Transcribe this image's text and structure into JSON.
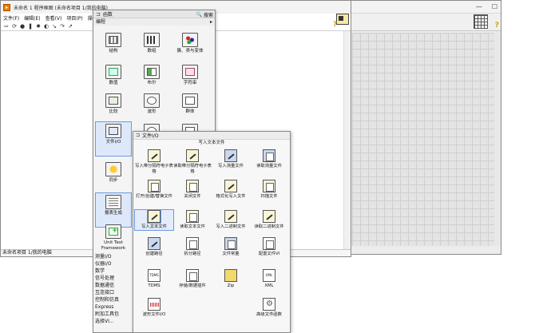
{
  "block_diagram": {
    "title": "未命名 1 程序框图 (未命名项目 1/我的电脑)",
    "menu": [
      "文件(F)",
      "编辑(E)",
      "查看(V)",
      "项目(P)",
      "操作"
    ],
    "status": "未命名项目 1/我的电脑"
  },
  "functions_palette": {
    "title": "函数",
    "search_label": "搜索",
    "category": "编程",
    "items": [
      {
        "label": "结构",
        "icon": "structures-icon"
      },
      {
        "label": "数组",
        "icon": "array-icon"
      },
      {
        "label": "簇、类与变体",
        "icon": "cluster-icon"
      },
      {
        "label": "数值",
        "icon": "numeric-icon"
      },
      {
        "label": "布尔",
        "icon": "boolean-icon"
      },
      {
        "label": "字符串",
        "icon": "string-icon"
      },
      {
        "label": "比较",
        "icon": "comparison-icon"
      },
      {
        "label": "波形",
        "icon": "waveform-icon"
      },
      {
        "label": "群体",
        "icon": "group-icon"
      },
      {
        "label": "文件I/O",
        "icon": "file-io-icon"
      },
      {
        "label": "同步",
        "icon": "sync-icon"
      },
      {
        "label": "报表生成",
        "icon": "report-icon"
      },
      {
        "label": "Unit Test Framework",
        "icon": "unit-test-icon"
      }
    ],
    "categories": [
      "测量I/O",
      "仪器I/O",
      "数学",
      "信号处理",
      "数据通信",
      "互连接口",
      "控制和仿真",
      "Express",
      "附加工具包",
      "选择VI..."
    ]
  },
  "file_io_palette": {
    "title": "文件I/O",
    "tooltip": "写入文本文件",
    "items": [
      {
        "label": "写入带分隔符电子表格",
        "icon": "write-delimited-icon"
      },
      {
        "label": "读取带分隔符电子表格",
        "icon": "read-delimited-icon"
      },
      {
        "label": "写入测量文件",
        "icon": "write-measurement-icon"
      },
      {
        "label": "读取测量文件",
        "icon": "read-measurement-icon"
      },
      {
        "label": "打开/创建/替换文件",
        "icon": "open-file-icon"
      },
      {
        "label": "关闭文件",
        "icon": "close-file-icon"
      },
      {
        "label": "格式化写入文件",
        "icon": "format-write-icon"
      },
      {
        "label": "扫描文件",
        "icon": "scan-file-icon"
      },
      {
        "label": "写入文本文件",
        "icon": "write-text-icon"
      },
      {
        "label": "读取文本文件",
        "icon": "read-text-icon"
      },
      {
        "label": "写入二进制文件",
        "icon": "write-binary-icon"
      },
      {
        "label": "读取二进制文件",
        "icon": "read-binary-icon"
      },
      {
        "label": "创建路径",
        "icon": "build-path-icon"
      },
      {
        "label": "拆分路径",
        "icon": "strip-path-icon"
      },
      {
        "label": "文件常量",
        "icon": "file-constant-icon"
      },
      {
        "label": "配置文件VI",
        "icon": "config-file-icon"
      },
      {
        "label": "TDMS",
        "icon": "tdms-icon"
      },
      {
        "label": "存储/数据插件",
        "icon": "storage-icon"
      },
      {
        "label": "Zip",
        "icon": "zip-icon"
      },
      {
        "label": "XML",
        "icon": "xml-icon"
      },
      {
        "label": "波形文件I/O",
        "icon": "waveform-file-icon"
      },
      {
        "label": "高级文件函数",
        "icon": "advanced-file-icon"
      }
    ]
  }
}
